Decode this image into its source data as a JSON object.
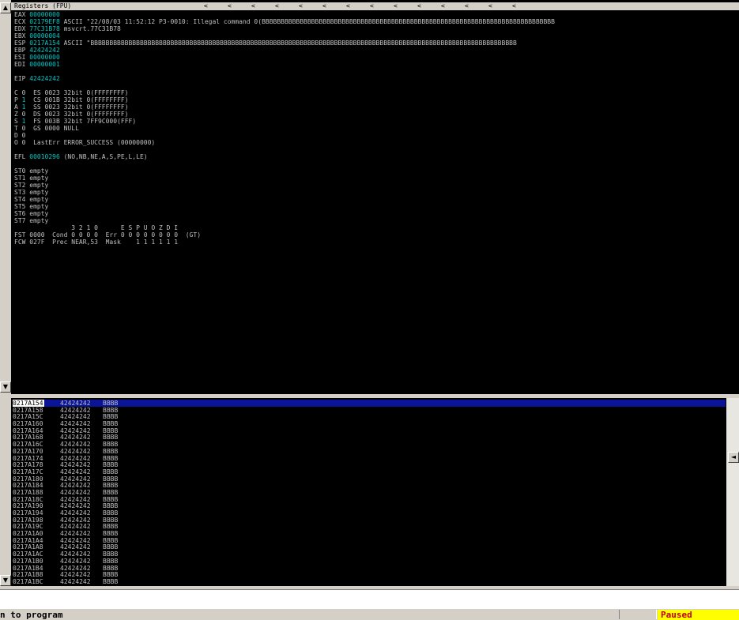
{
  "registers": {
    "title": "Registers (FPU)",
    "nav_arrows": [
      "<",
      "<",
      "<",
      "<",
      "<",
      "<",
      "<",
      "<",
      "<",
      "<",
      "<",
      "<",
      "<",
      "<"
    ],
    "lines": [
      [
        "EAX ",
        "00000000",
        ""
      ],
      [
        "ECX ",
        "02179EF8",
        " ASCII \"22/08/03 11:52:12 P3-0010: Illegal command 0(BBBBBBBBBBBBBBBBBBBBBBBBBBBBBBBBBBBBBBBBBBBBBBBBBBBBBBBBBBBBBBBBBBBBBBBBBBBBB"
      ],
      [
        "EDX ",
        "77C31B78",
        " msvcrt.77C31B78"
      ],
      [
        "EBX ",
        "00000004",
        ""
      ],
      [
        "ESP ",
        "0217A154",
        " ASCII \"BBBBBBBBBBBBBBBBBBBBBBBBBBBBBBBBBBBBBBBBBBBBBBBBBBBBBBBBBBBBBBBBBBBBBBBBBBBBBBBBBBBBBBBBBBBBBBBBBBBBBBBBBBBBBBBB"
      ],
      [
        "EBP ",
        "42424242",
        ""
      ],
      [
        "ESI ",
        "00000000",
        ""
      ],
      [
        "EDI ",
        "00000001",
        ""
      ],
      [
        "",
        "",
        ""
      ],
      [
        "EIP ",
        "42424242",
        ""
      ],
      [
        "",
        "",
        ""
      ],
      [
        "C 0  ES 0023 32bit 0(FFFFFFFF)",
        "",
        ""
      ],
      [
        "P ",
        "1",
        "  CS 001B 32bit 0(FFFFFFFF)"
      ],
      [
        "A ",
        "1",
        "  SS 0023 32bit 0(FFFFFFFF)"
      ],
      [
        "Z 0  DS 0023 32bit 0(FFFFFFFF)",
        "",
        ""
      ],
      [
        "S ",
        "1",
        "  FS 003B 32bit 7FF9C000(FFF)"
      ],
      [
        "T 0  GS 0000 NULL",
        "",
        ""
      ],
      [
        "D 0",
        "",
        ""
      ],
      [
        "O 0  LastErr ERROR_SUCCESS (00000000)",
        "",
        ""
      ],
      [
        "",
        "",
        ""
      ],
      [
        "EFL ",
        "00010296",
        " (NO,NB,NE,A,S,PE,L,LE)"
      ],
      [
        "",
        "",
        ""
      ],
      [
        "ST0 empty",
        "",
        ""
      ],
      [
        "ST1 empty",
        "",
        ""
      ],
      [
        "ST2 empty",
        "",
        ""
      ],
      [
        "ST3 empty",
        "",
        ""
      ],
      [
        "ST4 empty",
        "",
        ""
      ],
      [
        "ST5 empty",
        "",
        ""
      ],
      [
        "ST6 empty",
        "",
        ""
      ],
      [
        "ST7 empty",
        "",
        ""
      ],
      [
        "               3 2 1 0      E S P U O Z D I",
        "",
        ""
      ],
      [
        "FST 0000  Cond 0 0 0 0  Err 0 0 0 0 0 0 0 0  (GT)",
        "",
        ""
      ],
      [
        "FCW 027F  Prec NEAR,53  Mask    1 1 1 1 1 1",
        "",
        ""
      ]
    ]
  },
  "stack": {
    "rows": [
      [
        "0217A154",
        "42424242",
        "BBBB"
      ],
      [
        "0217A158",
        "42424242",
        "BBBB"
      ],
      [
        "0217A15C",
        "42424242",
        "BBBB"
      ],
      [
        "0217A160",
        "42424242",
        "BBBB"
      ],
      [
        "0217A164",
        "42424242",
        "BBBB"
      ],
      [
        "0217A168",
        "42424242",
        "BBBB"
      ],
      [
        "0217A16C",
        "42424242",
        "BBBB"
      ],
      [
        "0217A170",
        "42424242",
        "BBBB"
      ],
      [
        "0217A174",
        "42424242",
        "BBBB"
      ],
      [
        "0217A178",
        "42424242",
        "BBBB"
      ],
      [
        "0217A17C",
        "42424242",
        "BBBB"
      ],
      [
        "0217A180",
        "42424242",
        "BBBB"
      ],
      [
        "0217A184",
        "42424242",
        "BBBB"
      ],
      [
        "0217A188",
        "42424242",
        "BBBB"
      ],
      [
        "0217A18C",
        "42424242",
        "BBBB"
      ],
      [
        "0217A190",
        "42424242",
        "BBBB"
      ],
      [
        "0217A194",
        "42424242",
        "BBBB"
      ],
      [
        "0217A198",
        "42424242",
        "BBBB"
      ],
      [
        "0217A19C",
        "42424242",
        "BBBB"
      ],
      [
        "0217A1A0",
        "42424242",
        "BBBB"
      ],
      [
        "0217A1A4",
        "42424242",
        "BBBB"
      ],
      [
        "0217A1A8",
        "42424242",
        "BBBB"
      ],
      [
        "0217A1AC",
        "42424242",
        "BBBB"
      ],
      [
        "0217A1B0",
        "42424242",
        "BBBB"
      ],
      [
        "0217A1B4",
        "42424242",
        "BBBB"
      ],
      [
        "0217A1B8",
        "42424242",
        "BBBB"
      ],
      [
        "0217A1BC",
        "42424242",
        "BBBB"
      ]
    ],
    "selected_index": 0
  },
  "scroll": {
    "up_glyph": "▲",
    "down_glyph": "▼",
    "left_glyph": "◄"
  },
  "status": {
    "message": "n to program",
    "state": "Paused"
  },
  "colors": {
    "background": "#000000",
    "text": "#c0c0c0",
    "highlight": "#00c8c8",
    "selection": "#0a1496",
    "paused_bg": "#ffff00",
    "paused_fg": "#c00000"
  },
  "icons": [
    "scroll-up-icon",
    "scroll-down-icon",
    "scroll-left-icon"
  ]
}
